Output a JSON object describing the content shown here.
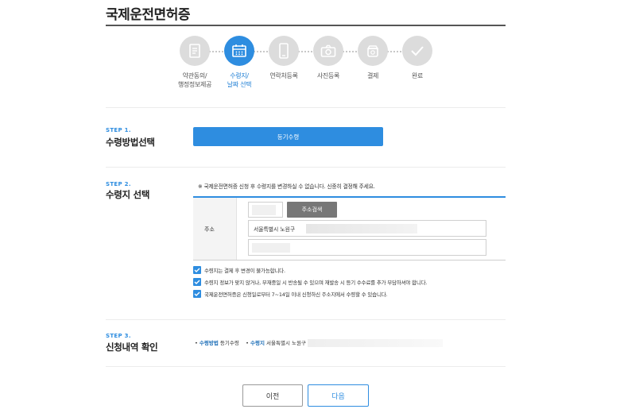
{
  "page": {
    "title": "국제운전면허증"
  },
  "stepper": {
    "steps": [
      {
        "label": "약관동의/\n행정정보제공",
        "icon": "document-icon",
        "active": false
      },
      {
        "label": "수령지/\n날짜 선택",
        "icon": "calendar-icon",
        "active": true
      },
      {
        "label": "연락처등록",
        "icon": "phone-icon",
        "active": false
      },
      {
        "label": "사진등록",
        "icon": "camera-icon",
        "active": false
      },
      {
        "label": "결제",
        "icon": "wallet-icon",
        "active": false
      },
      {
        "label": "완료",
        "icon": "check-icon",
        "active": false
      }
    ]
  },
  "step1": {
    "kicker": "STEP 1.",
    "title": "수령방법선택",
    "method_button": "등기수령"
  },
  "step2": {
    "kicker": "STEP 2.",
    "title": "수령지 선택",
    "notice": "※ 국제운전면허증 신청 후 수령지를 변경하실 수 없습니다. 신중히 결정해 주세요.",
    "address_label": "주소",
    "search_button": "주소검색",
    "address_line1": "서울특별시 노원구",
    "checks": [
      "수령지는 결제 후 변경이 불가능합니다.",
      "수령지 정보가 맞지 않거나, 부재중일 시 반송될 수 있으며 재발송 시 등기 수수료를 추가 부담하셔야 합니다.",
      "국제운전면허증은 신청일로부터 7~14일 이내 신청하신 주소지에서 수령할 수 있습니다."
    ]
  },
  "step3": {
    "kicker": "STEP 3.",
    "title": "신청내역 확인",
    "method_key": "수령방법",
    "method_value": "등기수령",
    "place_key": "수령지",
    "place_value": "서울특별시 노원구"
  },
  "footer": {
    "prev": "이전",
    "next": "다음"
  },
  "colors": {
    "accent": "#2e8de0",
    "inactive_step": "#dcdcdc"
  }
}
